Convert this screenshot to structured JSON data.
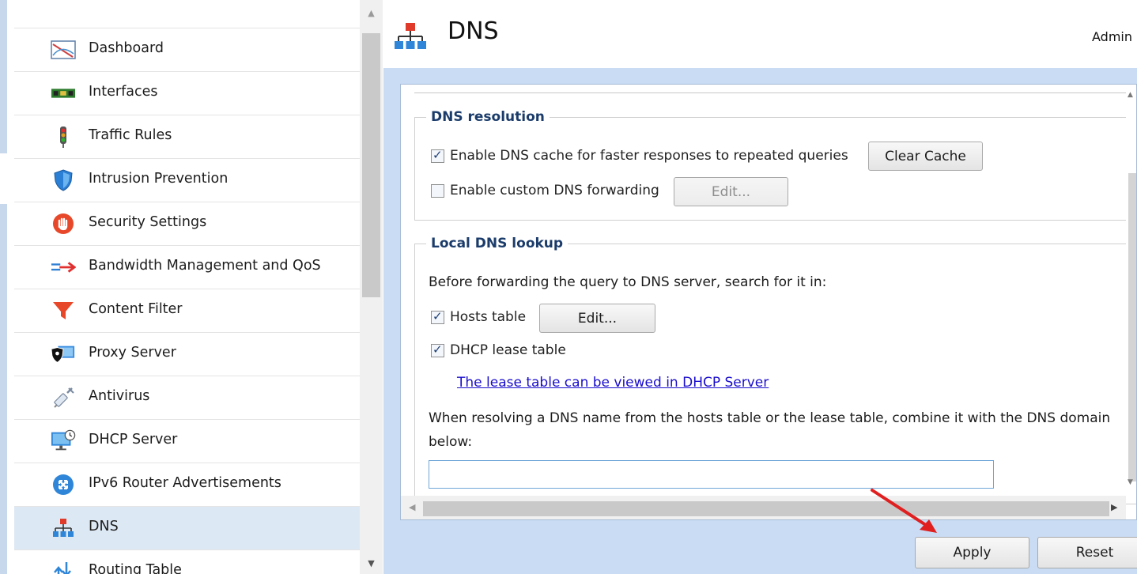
{
  "sidebar": {
    "items": [
      {
        "label": "Dashboard",
        "icon": "dashboard-icon"
      },
      {
        "label": "Interfaces",
        "icon": "network-card-icon"
      },
      {
        "label": "Traffic Rules",
        "icon": "traffic-light-icon"
      },
      {
        "label": "Intrusion Prevention",
        "icon": "shield-icon"
      },
      {
        "label": "Security Settings",
        "icon": "stop-hand-icon"
      },
      {
        "label": "Bandwidth Management and QoS",
        "icon": "bandwidth-arrow-icon"
      },
      {
        "label": "Content Filter",
        "icon": "funnel-icon"
      },
      {
        "label": "Proxy Server",
        "icon": "proxy-icon"
      },
      {
        "label": "Antivirus",
        "icon": "syringe-icon"
      },
      {
        "label": "DHCP Server",
        "icon": "dhcp-monitor-icon"
      },
      {
        "label": "IPv6 Router Advertisements",
        "icon": "ipv6-router-icon"
      },
      {
        "label": "DNS",
        "icon": "dns-network-icon",
        "selected": true
      },
      {
        "label": "Routing Table",
        "icon": "routing-icon"
      }
    ]
  },
  "header": {
    "title": "DNS",
    "user": "Admin"
  },
  "dns_resolution": {
    "legend": "DNS resolution",
    "cache_label": "Enable DNS cache for faster responses to repeated queries",
    "cache_checked": true,
    "clear_cache_label": "Clear Cache",
    "forwarding_label": "Enable custom DNS forwarding",
    "forwarding_checked": false,
    "forwarding_edit_label": "Edit..."
  },
  "local_dns": {
    "legend": "Local DNS lookup",
    "intro": "Before forwarding the query to DNS server, search for it in:",
    "hosts_label": "Hosts table",
    "hosts_checked": true,
    "hosts_edit_label": "Edit...",
    "dhcp_label": "DHCP lease table",
    "dhcp_checked": true,
    "lease_link": "The lease table can be viewed in DHCP Server",
    "combine_line1": "When resolving a DNS name from the hosts table or the lease table, combine it with the DNS domain",
    "combine_line2": "below:",
    "domain_value": ""
  },
  "actions": {
    "apply": "Apply",
    "reset": "Reset"
  },
  "colors": {
    "accent": "#1b3c6b",
    "panel_bg": "#c9dcf4",
    "selected_item": "#dde8f5",
    "link": "#1a0dcc",
    "annotation_arrow": "#e02020"
  }
}
